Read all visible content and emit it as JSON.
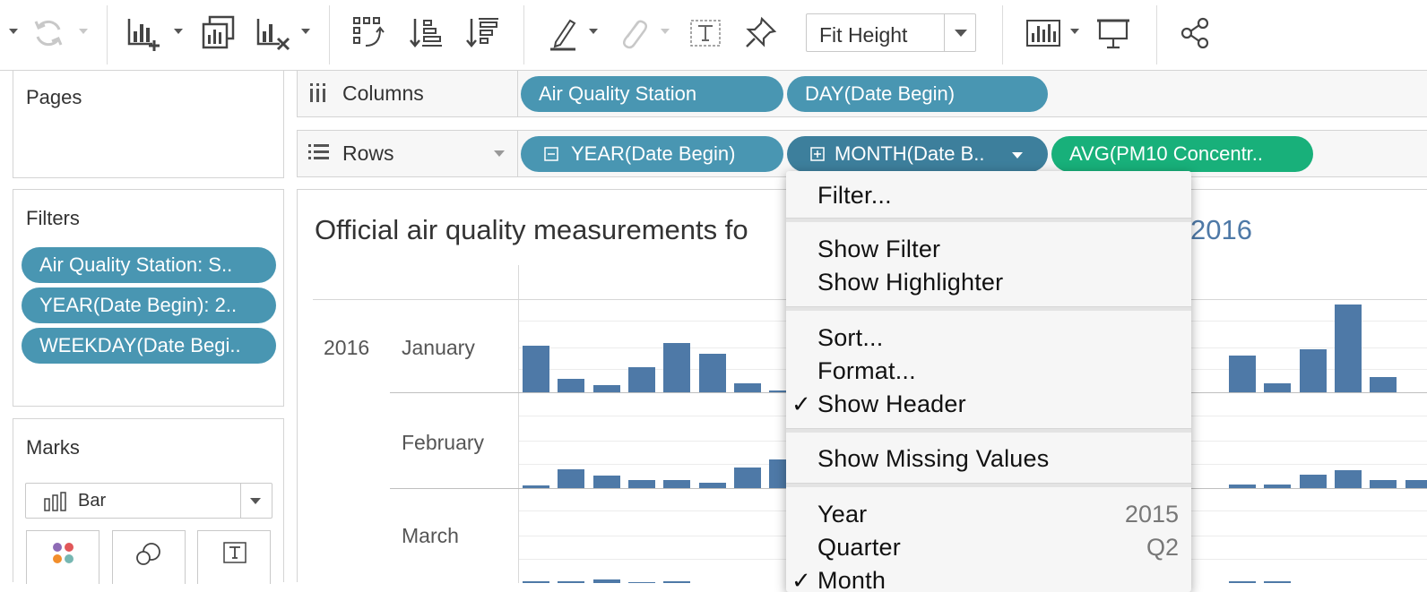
{
  "toolbar": {
    "fit_label": "Fit Height"
  },
  "panes": {
    "pages_title": "Pages",
    "filters_title": "Filters",
    "filters": [
      "Air Quality Station: S..",
      "YEAR(Date Begin): 2..",
      "WEEKDAY(Date Begi.."
    ],
    "marks_title": "Marks",
    "mark_type": "Bar"
  },
  "shelves": {
    "columns_label": "Columns",
    "columns_pills": [
      "Air Quality Station",
      "DAY(Date Begin)"
    ],
    "rows_label": "Rows",
    "rows_pills": [
      "YEAR(Date Begin)",
      "MONTH(Date B..",
      "AVG(PM10 Concentr.."
    ]
  },
  "view": {
    "title_left": "Official air quality measurements fo",
    "title_year": "2016",
    "year_label": "2016",
    "months": [
      "January",
      "February",
      "March"
    ],
    "bar_color": "#4e79a7"
  },
  "menu": {
    "items": {
      "filter": "Filter...",
      "show_filter": "Show Filter",
      "show_highlighter": "Show Highlighter",
      "sort": "Sort...",
      "format": "Format...",
      "show_header": "Show Header",
      "show_header_check": "✓",
      "show_missing": "Show Missing Values",
      "year": "Year",
      "year_value": "2015",
      "quarter": "Quarter",
      "quarter_value": "Q2",
      "month": "Month"
    }
  },
  "chart_data": {
    "type": "bar",
    "series": [
      {
        "name": "January",
        "values_left": [
          0.5,
          0.14,
          0.08,
          0.27,
          0.53,
          0.41,
          0.1,
          0.02
        ],
        "values_right": [
          0.39,
          0.1,
          0.46,
          0.94,
          0.16
        ]
      },
      {
        "name": "February",
        "values_left": [
          0.03,
          0.2,
          0.13,
          0.09,
          0.09,
          0.06,
          0.22,
          0.31
        ],
        "values_right": [
          0.04,
          0.04,
          0.14,
          0.19,
          0.09,
          0.09
        ]
      },
      {
        "name": "March",
        "values_left": [
          0.02,
          0.02,
          0.04,
          0,
          0.02
        ],
        "values_right": [
          0.02,
          0.02
        ]
      }
    ]
  }
}
